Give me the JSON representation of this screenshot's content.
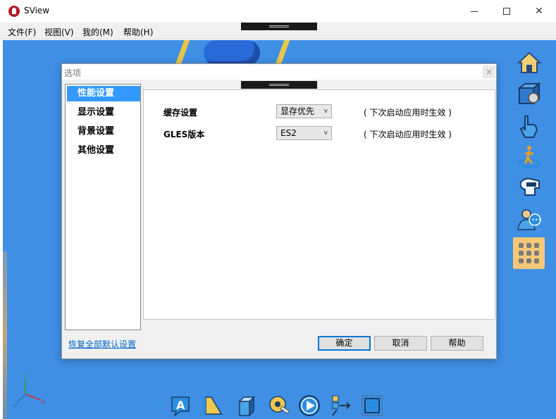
{
  "app": {
    "title": "SView"
  },
  "menu": {
    "items": [
      "文件(F)",
      "视图(V)",
      "我的(M)",
      "帮助(H)"
    ]
  },
  "dialog": {
    "title": "选项",
    "close_label": "×",
    "nav": [
      {
        "label": "性能设置",
        "active": true
      },
      {
        "label": "显示设置",
        "active": false
      },
      {
        "label": "背景设置",
        "active": false
      },
      {
        "label": "其他设置",
        "active": false
      }
    ],
    "settings": [
      {
        "label": "缓存设置",
        "value": "显存优先",
        "note": "( 下次启动应用时生效 )"
      },
      {
        "label": "GLES版本",
        "value": "ES2",
        "note": "( 下次启动应用时生效 )"
      }
    ],
    "reset_label": "恢复全部默认设置",
    "buttons": {
      "ok": "确定",
      "cancel": "取消",
      "help": "帮助"
    }
  },
  "axis": {
    "x": "X",
    "y": "Y",
    "z": "Z"
  },
  "colors": {
    "viewport_bg": "#3f8fe4",
    "accent": "#3399ff",
    "link": "#0066cc",
    "active_tool_bg": "#f5c778"
  },
  "right_toolbar_icons": [
    "home-icon",
    "view-cube-icon",
    "hand-pointer-icon",
    "walk-icon",
    "head-view-icon",
    "users-icon",
    "grid-apps-icon"
  ],
  "bottom_toolbar_icons": [
    "annotation-a-icon",
    "ruler-icon",
    "section-cube-icon",
    "measure-tape-icon",
    "play-icon",
    "explode-icon",
    "frame-select-icon"
  ]
}
